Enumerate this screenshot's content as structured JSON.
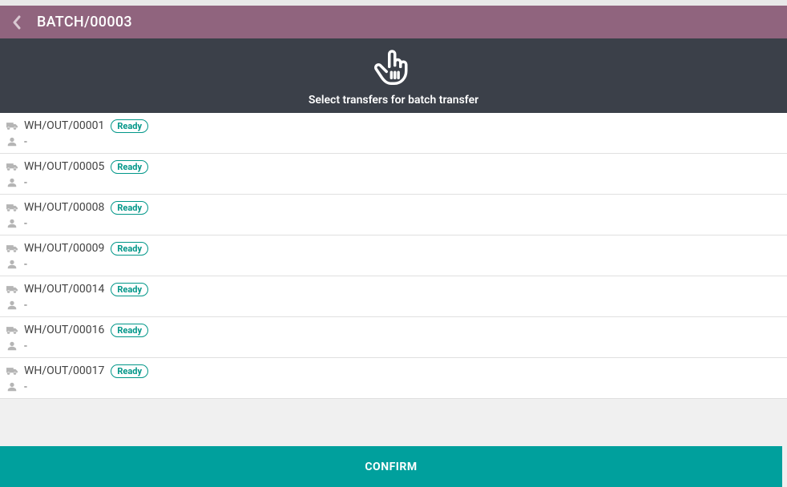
{
  "header": {
    "title": "BATCH/00003"
  },
  "banner": {
    "message": "Select transfers for batch transfer"
  },
  "transfers": [
    {
      "name": "WH/OUT/00001",
      "status": "Ready",
      "responsible": "-"
    },
    {
      "name": "WH/OUT/00005",
      "status": "Ready",
      "responsible": "-"
    },
    {
      "name": "WH/OUT/00008",
      "status": "Ready",
      "responsible": "-"
    },
    {
      "name": "WH/OUT/00009",
      "status": "Ready",
      "responsible": "-"
    },
    {
      "name": "WH/OUT/00014",
      "status": "Ready",
      "responsible": "-"
    },
    {
      "name": "WH/OUT/00016",
      "status": "Ready",
      "responsible": "-"
    },
    {
      "name": "WH/OUT/00017",
      "status": "Ready",
      "responsible": "-"
    }
  ],
  "actions": {
    "confirm_label": "CONFIRM"
  },
  "icons": {
    "back": "chevron-left",
    "truck": "truck",
    "user": "user",
    "pointer": "hand-pointer"
  },
  "colors": {
    "header_bg": "#90647e",
    "banner_bg": "#3b4049",
    "accent": "#009688",
    "confirm_bg": "#00a09d"
  }
}
